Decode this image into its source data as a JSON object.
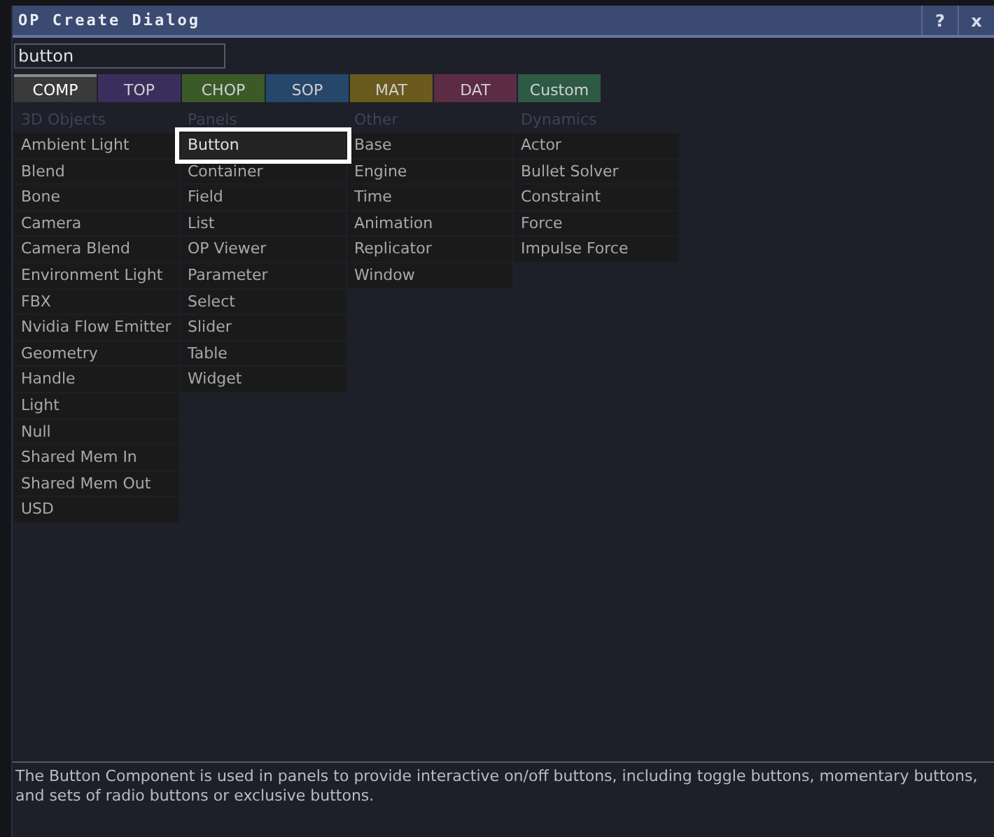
{
  "window": {
    "title": "OP Create Dialog",
    "buttons": [
      "?",
      "x"
    ]
  },
  "search": {
    "value": "button"
  },
  "tabs": [
    {
      "label": "COMP",
      "color": "#3a3a3a",
      "selected": true
    },
    {
      "label": "TOP",
      "color": "#3a2f5c",
      "selected": false
    },
    {
      "label": "CHOP",
      "color": "#3c5a28",
      "selected": false
    },
    {
      "label": "SOP",
      "color": "#26476a",
      "selected": false
    },
    {
      "label": "MAT",
      "color": "#6a5a1e",
      "selected": false
    },
    {
      "label": "DAT",
      "color": "#5c2c44",
      "selected": false
    },
    {
      "label": "Custom",
      "color": "#2c5a44",
      "selected": false
    }
  ],
  "columns": [
    {
      "heading": "3D Objects",
      "items": [
        {
          "label": "Ambient Light",
          "selected": false
        },
        {
          "label": "Blend",
          "selected": false
        },
        {
          "label": "Bone",
          "selected": false
        },
        {
          "label": "Camera",
          "selected": false
        },
        {
          "label": "Camera Blend",
          "selected": false
        },
        {
          "label": "Environment Light",
          "selected": false
        },
        {
          "label": "FBX",
          "selected": false
        },
        {
          "label": "Nvidia Flow Emitter",
          "selected": false
        },
        {
          "label": "Geometry",
          "selected": false
        },
        {
          "label": "Handle",
          "selected": false
        },
        {
          "label": "Light",
          "selected": false
        },
        {
          "label": "Null",
          "selected": false
        },
        {
          "label": "Shared Mem In",
          "selected": false
        },
        {
          "label": "Shared Mem Out",
          "selected": false
        },
        {
          "label": "USD",
          "selected": false
        }
      ]
    },
    {
      "heading": "Panels",
      "items": [
        {
          "label": "Button",
          "selected": true
        },
        {
          "label": "Container",
          "selected": false
        },
        {
          "label": "Field",
          "selected": false
        },
        {
          "label": "List",
          "selected": false
        },
        {
          "label": "OP Viewer",
          "selected": false
        },
        {
          "label": "Parameter",
          "selected": false
        },
        {
          "label": "Select",
          "selected": false
        },
        {
          "label": "Slider",
          "selected": false
        },
        {
          "label": "Table",
          "selected": false
        },
        {
          "label": "Widget",
          "selected": false
        }
      ]
    },
    {
      "heading": "Other",
      "items": [
        {
          "label": "Base",
          "selected": false
        },
        {
          "label": "Engine",
          "selected": false
        },
        {
          "label": "Time",
          "selected": false
        },
        {
          "label": "Animation",
          "selected": false
        },
        {
          "label": "Replicator",
          "selected": false
        },
        {
          "label": "Window",
          "selected": false
        }
      ]
    },
    {
      "heading": "Dynamics",
      "items": [
        {
          "label": "Actor",
          "selected": false
        },
        {
          "label": "Bullet Solver",
          "selected": false
        },
        {
          "label": "Constraint",
          "selected": false
        },
        {
          "label": "Force",
          "selected": false
        },
        {
          "label": "Impulse Force",
          "selected": false
        }
      ]
    }
  ],
  "description": "The Button Component is used in panels to provide interactive on/off buttons, including toggle buttons, momentary buttons, and sets of radio buttons or exclusive buttons."
}
